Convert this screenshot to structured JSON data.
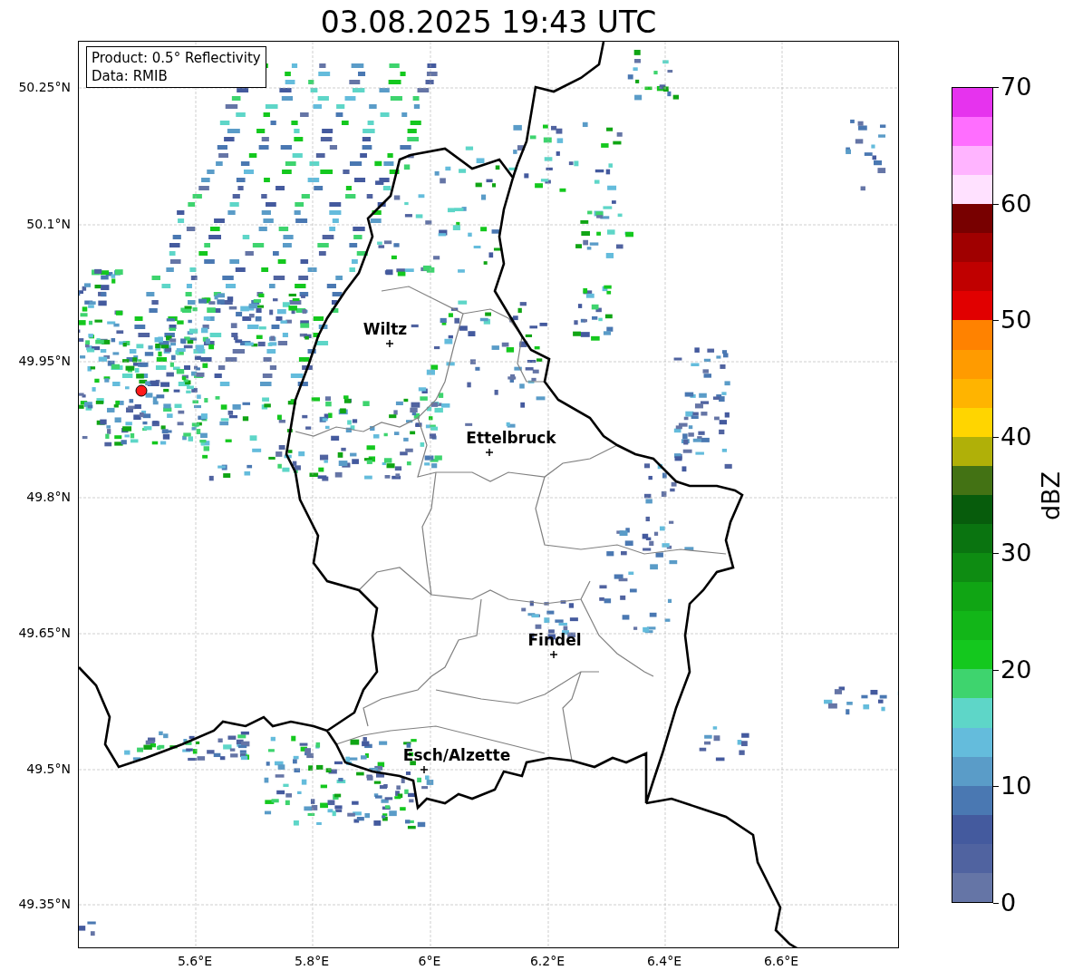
{
  "title": "03.08.2025 19:43 UTC",
  "info_box": {
    "lines": [
      "Product: 0.5° Reflectivity",
      "Data: RMIB"
    ]
  },
  "map": {
    "y_ticks": [
      "50.25°N",
      "50.1°N",
      "49.95°N",
      "49.8°N",
      "49.65°N",
      "49.5°N",
      "49.35°N"
    ],
    "x_ticks": [
      "5.6°E",
      "5.8°E",
      "6°E",
      "6.2°E",
      "6.4°E",
      "6.6°E"
    ],
    "cities": [
      {
        "name": "Wiltz"
      },
      {
        "name": "Ettelbruck"
      },
      {
        "name": "Findel"
      },
      {
        "name": "Esch/Alzette"
      }
    ]
  },
  "colorbar": {
    "label": "dBZ",
    "ticks": [
      "70",
      "60",
      "50",
      "40",
      "30",
      "20",
      "10",
      "0"
    ]
  }
}
